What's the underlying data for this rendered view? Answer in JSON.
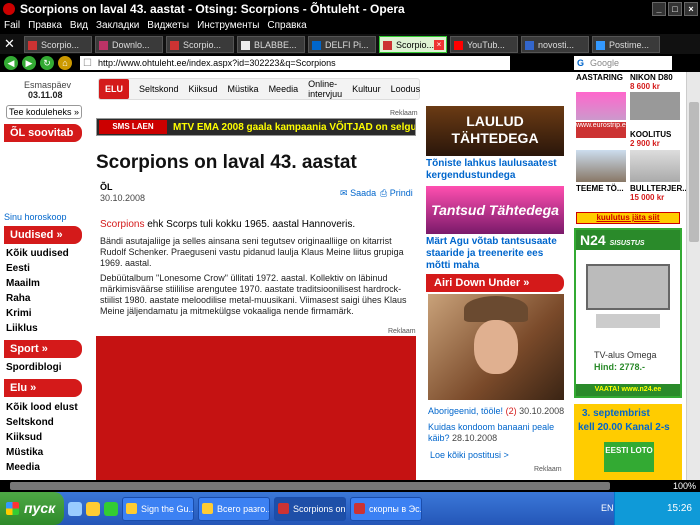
{
  "window": {
    "title": "Scorpions on laval 43. aastat - Otsing: Scorpions - Õhtuleht - Opera"
  },
  "menu": [
    "Fail",
    "Правка",
    "Вид",
    "Закладки",
    "Виджеты",
    "Инструменты",
    "Справка"
  ],
  "tabs": [
    {
      "label": "Scorpio...",
      "active": false
    },
    {
      "label": "Downlo...",
      "active": false
    },
    {
      "label": "Scorpio...",
      "active": false
    },
    {
      "label": "BLABBE...",
      "active": false
    },
    {
      "label": "DELFI Pi...",
      "active": false
    },
    {
      "label": "Scorpio...",
      "active": true
    },
    {
      "label": "YouTub...",
      "active": false
    },
    {
      "label": "novosti...",
      "active": false
    },
    {
      "label": "Postime...",
      "active": false
    }
  ],
  "address": {
    "url": "http://www.ohtuleht.ee/index.aspx?id=302223&q=Scorpions",
    "search_placeholder": "Google"
  },
  "left": {
    "weekday": "Esmaspäev",
    "date": "03.11.08",
    "home_button": "Tee koduleheks »",
    "recommended": "ÕL soovitab",
    "horoscope": "Sinu horoskoop",
    "news_header": "Uudised »",
    "news_links": [
      "Kõik uudised",
      "Eesti",
      "Maailm",
      "Raha",
      "Krimi",
      "Liiklus"
    ],
    "sport_header": "Sport »",
    "sport_links": [
      "Spordiblogi"
    ],
    "life_header": "Elu »",
    "life_links": [
      "Kõik lood elust",
      "Seltskond",
      "Kiiksud",
      "Müstika",
      "Meedia"
    ]
  },
  "nav": [
    "ELU",
    "Seltskond",
    "Kiiksud",
    "Müstika",
    "Meedia",
    "Online-intervjuu",
    "Kultuur",
    "Loodus"
  ],
  "ad": {
    "logo": "SMS LAEN",
    "text": "MTV EMA 2008 gaala kampaania VÕITJAD on selgunud!",
    "tag": "Reklaam"
  },
  "article": {
    "title": "Scorpions on laval 43. aastat",
    "author": "ÕL",
    "date": "30.10.2008",
    "share": "Saada",
    "print": "Prindi",
    "lead_highlight": "Scorpions",
    "lead_rest": " ehk Scorps tuli kokku 1965. aastal Hannoveris.",
    "para1": "Bändi asutajaliige ja selles ainsana seni tegutsev originaalliige on kitarrist Rudolf Schenker. Praeguseni vastu pidanud laulja Klaus Meine liitus grupiga 1969. aastal.",
    "para2": "Debüütalbum \"Lonesome Crow\" üllitati 1972. aastal. Kollektiv on läbinud märkimisväärse stiililise arengutee 1970. aastate traditsioonilisest hardrock-stiilist 1980. aastate meloodilise metal-muusikani. Viimasest saigi ühes Klaus Meine jäljendamatu ja mitmekülgse vokaaliga nende firmamärk.",
    "ad_tag": "Reklaam"
  },
  "rightmid": {
    "promo1_title": "LAULUD TÄHTEDEGA",
    "promo1_caption": "Tõniste lahkus laulusaatest kergendustundega",
    "promo2_title": "Tantsud Tähtedega",
    "promo2_caption": "Märt Agu võtab tantsusaate staaride ja treenerite ees mõtti maha",
    "section": "Airi Down Under »",
    "photo_caption": "Aborigeenid, tööle!",
    "photo_count": "(2)",
    "photo_date": "30.10.2008",
    "story2": "Kuidas kondoom banaani peale käib?",
    "story2_date": "28.10.2008",
    "all_stories": "Loe kõiki postitusi >",
    "ad_tag": "Reklaam"
  },
  "farright": {
    "top_labels": [
      "AASTARING",
      "NIKON D80"
    ],
    "top_prices": [
      "8 600 kr"
    ],
    "mid_labels": [
      "KOOLITUS"
    ],
    "mid_prices": [
      "2 900 kr"
    ],
    "site": "www.eurostrip.ee",
    "bottom_labels": [
      "TEEME TÖ...",
      "BULLTERJER..."
    ],
    "bottom_prices": [
      "15 000 kr"
    ],
    "ad_link": "kuulutus jäta siit",
    "n24_logo": "N24",
    "n24_slogan": "SISUSTUS",
    "tv_label": "TV-alus Omega",
    "tv_price": "Hind: 2778.-",
    "n24_cta": "VAATA! www.n24.ee",
    "lotto_date": "3. septembrist",
    "lotto_time": "kell 20.00 Kanal 2-s",
    "lotto_brand": "EESTI LOTO"
  },
  "status": {
    "zoom": "100%"
  },
  "taskbar": {
    "start": "пуск",
    "tasks": [
      {
        "label": "Sign the Gu...",
        "active": false
      },
      {
        "label": "Всего разго...",
        "active": false
      },
      {
        "label": "Scorpions on...",
        "active": true
      },
      {
        "label": "скорпы в Эс...",
        "active": false
      }
    ],
    "lang": "EN",
    "clock": "15:26"
  },
  "colors": {
    "accent_red": "#d41a1a",
    "link_blue": "#0066cc",
    "tab_active": "#dff2d4",
    "taskbar_blue": "#2456b8"
  }
}
